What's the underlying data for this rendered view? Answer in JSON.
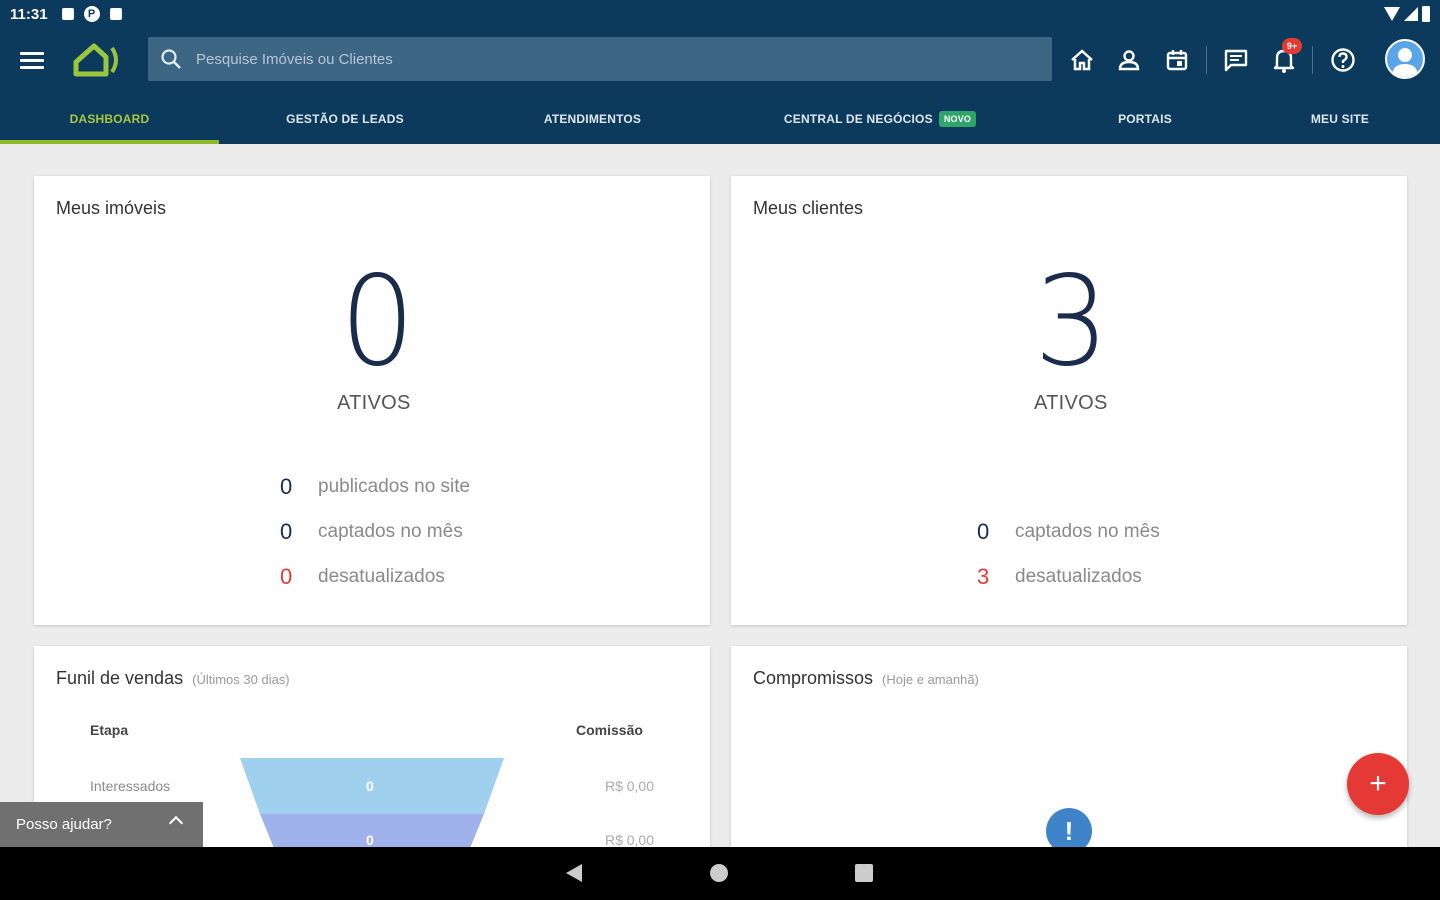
{
  "status_bar": {
    "time": "11:31"
  },
  "search": {
    "placeholder": "Pesquise Imóveis ou Clientes"
  },
  "header": {
    "notifications_badge": "9+",
    "icons": [
      "home-icon",
      "person-icon",
      "calendar-icon",
      "chat-icon",
      "bell-icon",
      "help-icon"
    ]
  },
  "tabs": [
    {
      "label": "DASHBOARD",
      "active": true
    },
    {
      "label": "GESTÃO DE LEADS"
    },
    {
      "label": "ATENDIMENTOS"
    },
    {
      "label": "CENTRAL DE NEGÓCIOS",
      "badge": "NOVO"
    },
    {
      "label": "PORTAIS"
    },
    {
      "label": "MEU SITE"
    }
  ],
  "imoveis_card": {
    "title": "Meus imóveis",
    "count": "0",
    "count_label": "ATIVOS",
    "stats": [
      {
        "value": "0",
        "label": "publicados no site"
      },
      {
        "value": "0",
        "label": "captados no mês"
      },
      {
        "value": "0",
        "label": "desatualizados"
      }
    ]
  },
  "clientes_card": {
    "title": "Meus clientes",
    "count": "3",
    "count_label": "ATIVOS",
    "stats": [
      {
        "value": "0",
        "label": "captados no mês"
      },
      {
        "value": "3",
        "label": "desatualizados"
      }
    ]
  },
  "funil_card": {
    "title": "Funil de vendas",
    "subtitle": "(Últimos 30 dias)",
    "col_etapa": "Etapa",
    "col_comissao": "Comissão",
    "rows": [
      {
        "etapa": "Interessados",
        "value": "0",
        "comissao": "R$ 0,00"
      },
      {
        "etapa": "",
        "value": "0",
        "comissao": "R$ 0,00"
      }
    ]
  },
  "compromissos_card": {
    "title": "Compromissos",
    "subtitle": "(Hoje e amanhã)"
  },
  "help_widget": {
    "label": "Posso ajudar?"
  },
  "fab": {
    "label": "+"
  },
  "colors": {
    "appbar": "#0b3a5c",
    "accent_green": "#8fb92c",
    "danger": "#e53935",
    "funnel_top": "#9fd0ee",
    "funnel_mid": "#9fb2ec"
  }
}
